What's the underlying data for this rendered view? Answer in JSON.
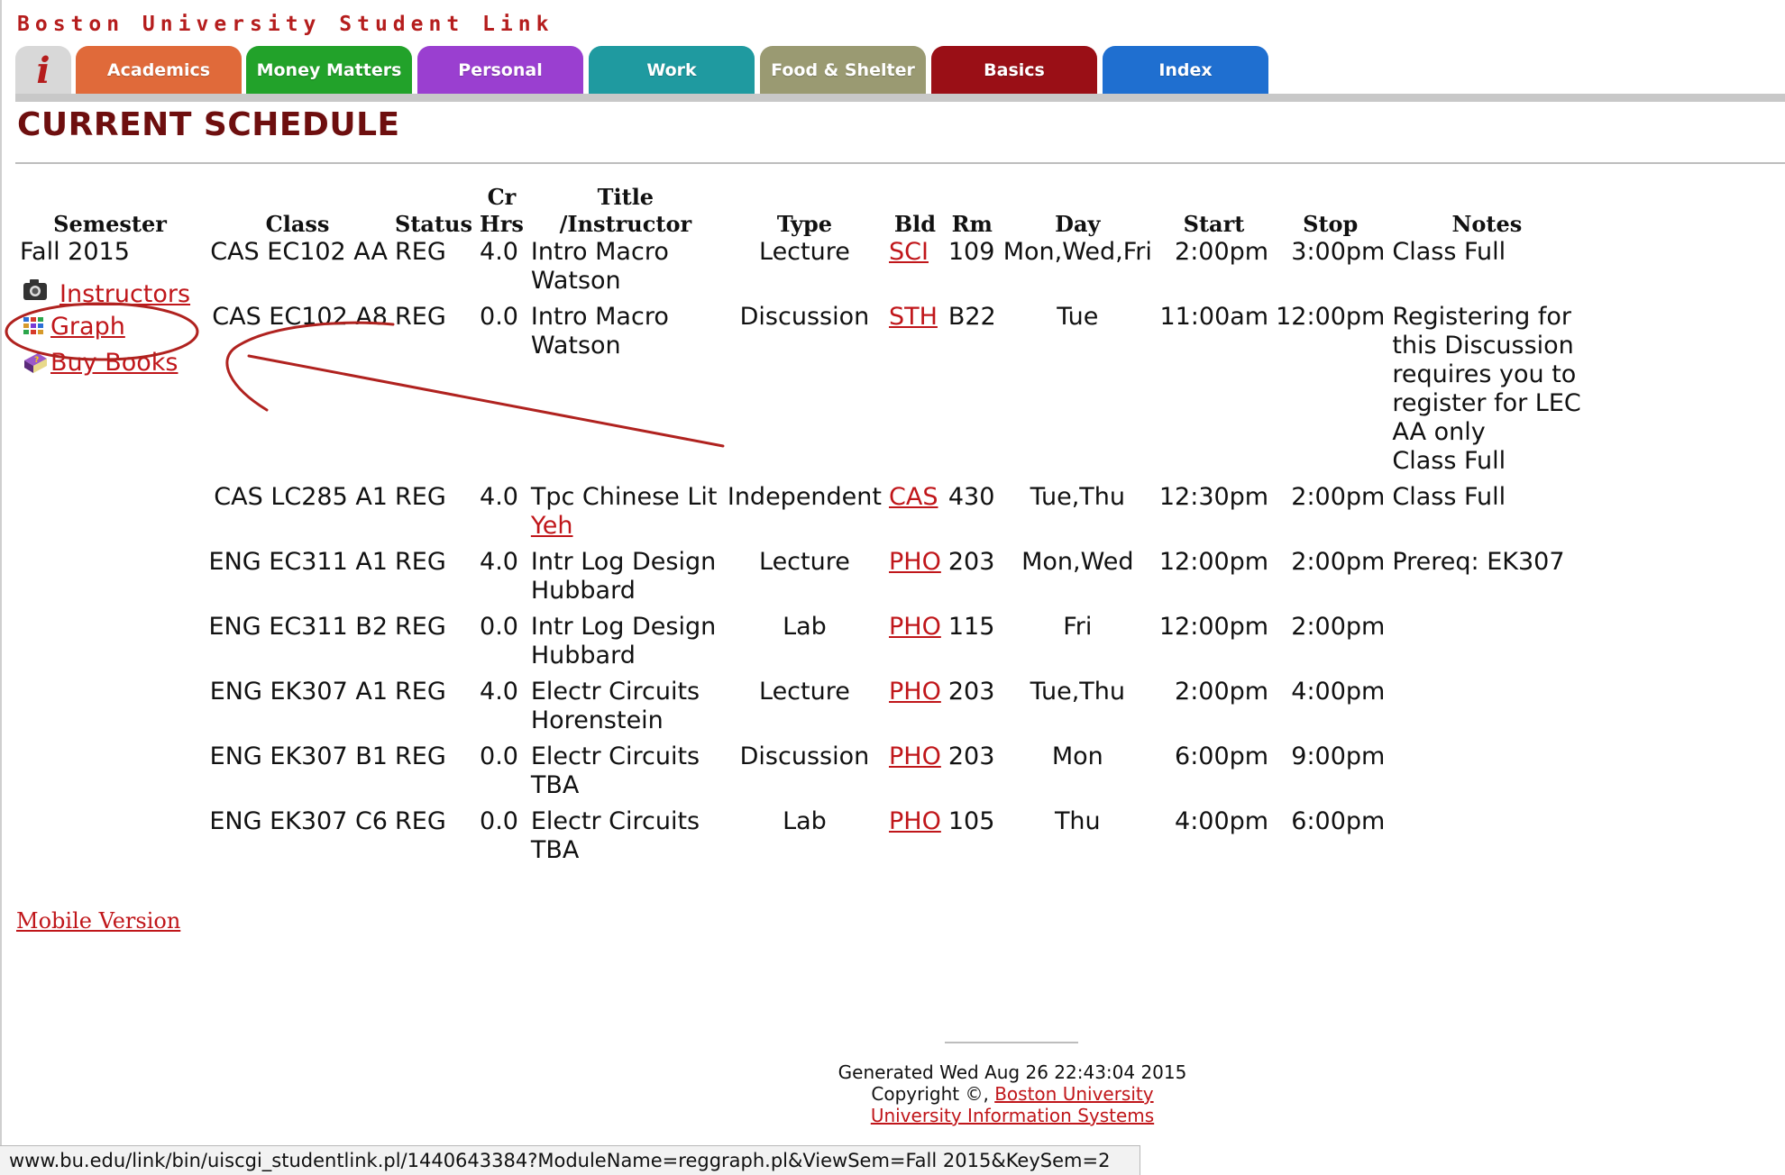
{
  "brand": "Boston University Student Link",
  "tabs": [
    {
      "label": "i",
      "color": "#d8d8d8"
    },
    {
      "label": "Academics",
      "color": "#e06a3a"
    },
    {
      "label": "Money Matters",
      "color": "#22a22a"
    },
    {
      "label": "Personal",
      "color": "#9a3fd0"
    },
    {
      "label": "Work",
      "color": "#1f9aa0"
    },
    {
      "label": "Food & Shelter",
      "color": "#9a9a72"
    },
    {
      "label": "Basics",
      "color": "#9a0f16"
    },
    {
      "label": "Index",
      "color": "#1f6fd0"
    }
  ],
  "page_title": "CURRENT SCHEDULE",
  "side_links": {
    "instructors": "Instructors",
    "graph": "Graph",
    "buy_books": "Buy Books"
  },
  "table": {
    "headers": {
      "semester": "Semester",
      "class": "Class",
      "status": "Status",
      "cr_line1": "Cr",
      "cr_line2": "Hrs",
      "title_line1": "Title",
      "title_line2": "/Instructor",
      "type": "Type",
      "bld": "Bld",
      "rm": "Rm",
      "day": "Day",
      "start": "Start",
      "stop": "Stop",
      "notes": "Notes"
    },
    "semester": "Fall 2015",
    "rows": [
      {
        "class": "CAS EC102 AA",
        "status": "REG",
        "cr": "4.0",
        "title": "Intro Macro",
        "instructor": "Watson",
        "type": "Lecture",
        "bld": "SCI",
        "rm": "109",
        "day": "Mon,Wed,Fri",
        "start": "2:00pm",
        "stop": "3:00pm",
        "notes": "Class Full"
      },
      {
        "class": "CAS EC102 A8",
        "status": "REG",
        "cr": "0.0",
        "title": "Intro Macro",
        "instructor": "Watson",
        "type": "Discussion",
        "bld": "STH",
        "rm": "B22",
        "day": "Tue",
        "start": "11:00am",
        "stop": "12:00pm",
        "notes": "Registering for this Discussion requires you to register for LEC AA only",
        "notes2": "Class Full"
      },
      {
        "class": "CAS LC285 A1",
        "status": "REG",
        "cr": "4.0",
        "title": "Tpc Chinese Lit",
        "instructor": "Yeh",
        "type": "Independent",
        "bld": "CAS",
        "rm": "430",
        "day": "Tue,Thu",
        "start": "12:30pm",
        "stop": "2:00pm",
        "notes": "Class Full"
      },
      {
        "class": "ENG EC311 A1",
        "status": "REG",
        "cr": "4.0",
        "title": "Intr Log Design",
        "instructor": "Hubbard",
        "type": "Lecture",
        "bld": "PHO",
        "rm": "203",
        "day": "Mon,Wed",
        "start": "12:00pm",
        "stop": "2:00pm",
        "notes": "Prereq: EK307"
      },
      {
        "class": "ENG EC311 B2",
        "status": "REG",
        "cr": "0.0",
        "title": "Intr Log Design",
        "instructor": "Hubbard",
        "type": "Lab",
        "bld": "PHO",
        "rm": "115",
        "day": "Fri",
        "start": "12:00pm",
        "stop": "2:00pm",
        "notes": ""
      },
      {
        "class": "ENG EK307 A1",
        "status": "REG",
        "cr": "4.0",
        "title": "Electr Circuits",
        "instructor": "Horenstein",
        "type": "Lecture",
        "bld": "PHO",
        "rm": "203",
        "day": "Tue,Thu",
        "start": "2:00pm",
        "stop": "4:00pm",
        "notes": ""
      },
      {
        "class": "ENG EK307 B1",
        "status": "REG",
        "cr": "0.0",
        "title": "Electr Circuits",
        "instructor": "TBA",
        "type": "Discussion",
        "bld": "PHO",
        "rm": "203",
        "day": "Mon",
        "start": "6:00pm",
        "stop": "9:00pm",
        "notes": ""
      },
      {
        "class": "ENG EK307 C6",
        "status": "REG",
        "cr": "0.0",
        "title": "Electr Circuits",
        "instructor": "TBA",
        "type": "Lab",
        "bld": "PHO",
        "rm": "105",
        "day": "Thu",
        "start": "4:00pm",
        "stop": "6:00pm",
        "notes": ""
      }
    ]
  },
  "mobile_link": "Mobile Version",
  "footer": {
    "generated": "Generated Wed Aug 26 22:43:04 2015",
    "copyright": "Copyright ©,",
    "bu_link": "Boston University",
    "uis_link": "University Information Systems"
  },
  "status_url": "www.bu.edu/link/bin/uiscgi_studentlink.pl/1440643384?ModuleName=reggraph.pl&ViewSem=Fall 2015&KeySem=2",
  "annotation_color": "#b0221f"
}
